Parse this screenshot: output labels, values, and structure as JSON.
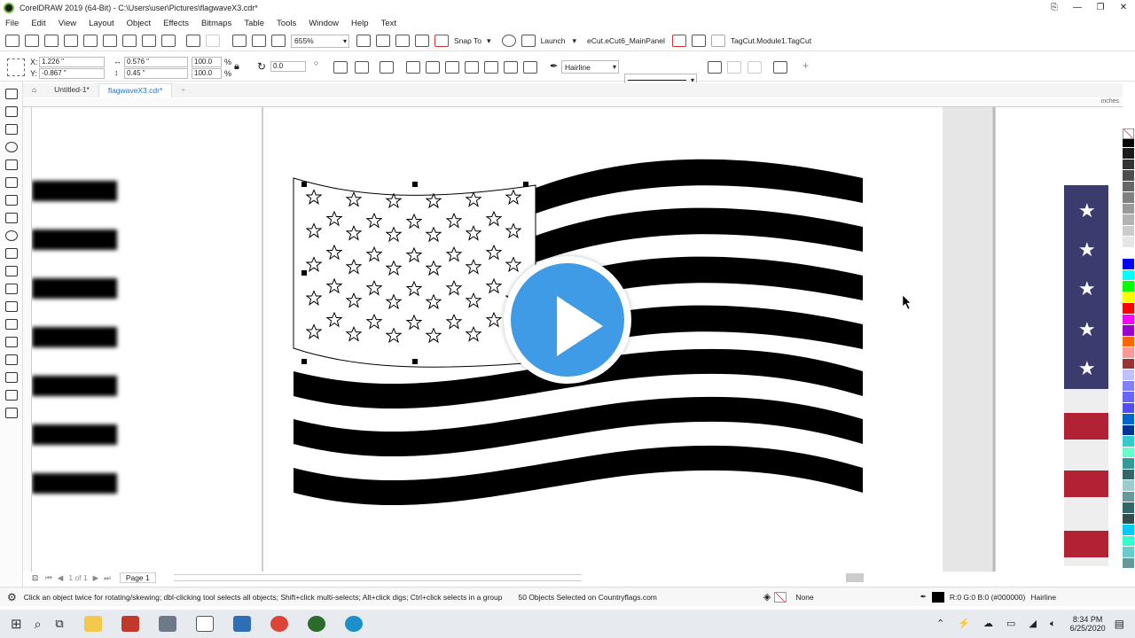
{
  "window": {
    "title": "CorelDRAW 2019 (64-Bit) - C:\\Users\\user\\Pictures\\flagwaveX3.cdr*"
  },
  "menu": [
    "File",
    "Edit",
    "View",
    "Layout",
    "Object",
    "Effects",
    "Bitmaps",
    "Table",
    "Tools",
    "Window",
    "Help",
    "Text"
  ],
  "toolbar": {
    "zoom_value": "655%",
    "snap_to_label": "Snap To",
    "launch_label": "Launch",
    "panel_label": "eCut.eCut6_MainPanel",
    "tagcut_label": "TagCut.Module1.TagCut"
  },
  "property_bar": {
    "x_label": "X:",
    "x_value": "1.226 \"",
    "y_label": "Y:",
    "y_value": "-0.867 \"",
    "width_value": "0.576 \"",
    "height_value": "0.45 \"",
    "scale_w": "100.0",
    "scale_h": "100.0",
    "percent": "%",
    "rotation": "0.0",
    "outline_width": "Hairline"
  },
  "doc_tabs": [
    {
      "label": "Untitled-1*",
      "active": false
    },
    {
      "label": "flagwaveX3.cdr*",
      "active": true
    }
  ],
  "ruler_unit": "inches",
  "page_nav": {
    "page_label": "Page 1"
  },
  "status": {
    "hint": "Click an object twice for rotating/skewing; dbl-clicking tool selects all objects; Shift+click multi-selects; Alt+click digs; Ctrl+click selects in a group",
    "selection": "50 Objects Selected on Countryflags.com",
    "fill_label": "None",
    "outline_color": "R:0 G:0 B:0 (#000000)",
    "outline_width": "Hairline"
  },
  "taskbar": {
    "time": "8:34 PM",
    "date": "6/25/2020"
  },
  "palette_colors": [
    "#ffffff",
    "#000000",
    "#1a1a1a",
    "#333333",
    "#4d4d4d",
    "#666666",
    "#808080",
    "#999999",
    "#b3b3b3",
    "#cccccc",
    "#e6e6e6",
    "#ffffff",
    "#0000ff",
    "#00ffff",
    "#00ff00",
    "#ffff00",
    "#ff0000",
    "#ff00ff",
    "#9900cc",
    "#ff6600",
    "#ff9999",
    "#993333",
    "#c0c0ff",
    "#8080ff",
    "#6666ff",
    "#4d4dff",
    "#0066cc",
    "#003399",
    "#33cccc",
    "#66ffcc",
    "#339999",
    "#336666",
    "#99cccc",
    "#669999",
    "#336666",
    "#334d4d",
    "#00ccff",
    "#33ffcc",
    "#66cccc",
    "#669999"
  ]
}
